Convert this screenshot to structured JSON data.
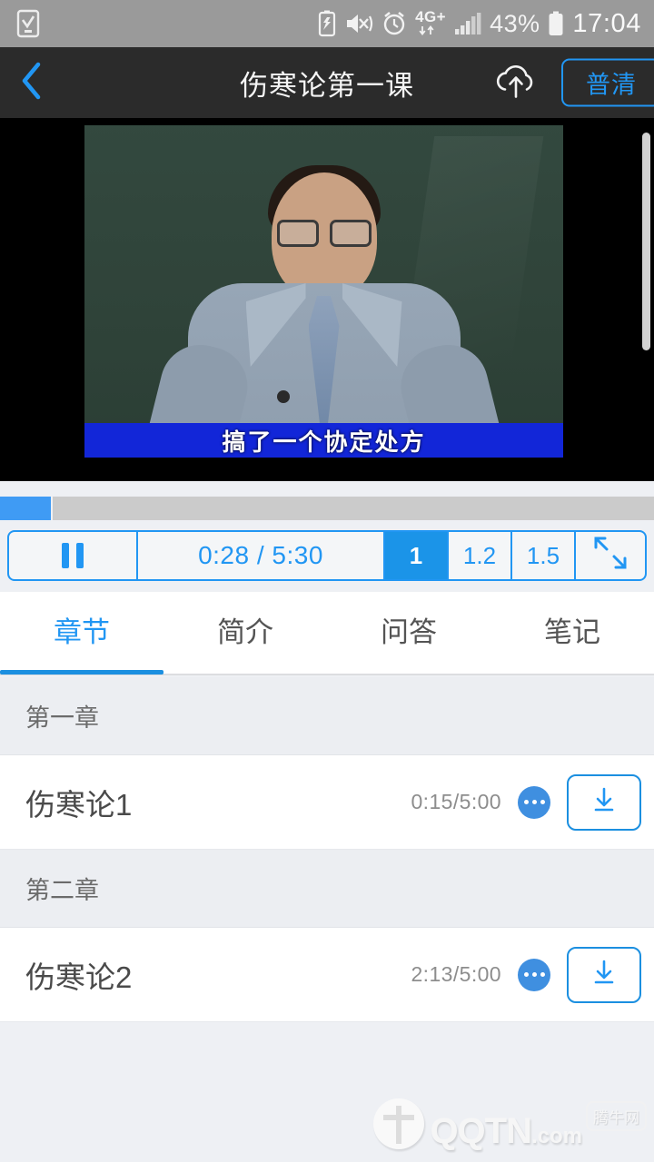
{
  "status_bar": {
    "left_icon": "task-checklist-icon",
    "icons": [
      "power-save-battery-icon",
      "mute-vibrate-icon",
      "alarm-clock-icon",
      "4g-plus-icon",
      "signal-bars-icon"
    ],
    "network_label": "4G+",
    "battery_percent": "43%",
    "battery_icon": "battery-icon",
    "time": "17:04",
    "background": "#9a9a9a"
  },
  "navbar": {
    "back_icon": "chevron-left-icon",
    "title": "伤寒论第一课",
    "cloud_icon": "cloud-upload-icon",
    "quality_label": "普清",
    "accent": "#2196f3",
    "background": "#2b2b2b"
  },
  "player": {
    "subtitle": "搞了一个协定处方",
    "subtitle_bar_color": "#1226d8",
    "scrollbar": "video-scrollbar",
    "progress": {
      "fill_color": "#3f9bf4",
      "track_color": "#cbcbcb",
      "percent": 8
    }
  },
  "controls": {
    "pause_icon": "pause-icon",
    "time_display": "0:28 / 5:30",
    "speeds": [
      {
        "label": "1",
        "active": true
      },
      {
        "label": "1.2",
        "active": false
      },
      {
        "label": "1.5",
        "active": false
      }
    ],
    "fullscreen_icon": "fullscreen-icon",
    "accent": "#2196f3",
    "active_bg": "#1b94e8"
  },
  "tabs": [
    {
      "label": "章节",
      "active": true
    },
    {
      "label": "简介",
      "active": false
    },
    {
      "label": "问答",
      "active": false
    },
    {
      "label": "笔记",
      "active": false
    }
  ],
  "chapters": [
    {
      "title": "第一章",
      "lessons": [
        {
          "title": "伤寒论1",
          "time": "0:15/5:00",
          "more_icon": "more-dots-icon",
          "download_icon": "download-icon"
        }
      ]
    },
    {
      "title": "第二章",
      "lessons": [
        {
          "title": "伤寒论2",
          "time": "2:13/5:00",
          "more_icon": "more-dots-icon",
          "download_icon": "download-icon"
        }
      ]
    }
  ],
  "watermark": {
    "logo_icon": "qqtn-logo-icon",
    "brand": "QQTN",
    "suffix": ".com",
    "badge": "腾牛网"
  }
}
